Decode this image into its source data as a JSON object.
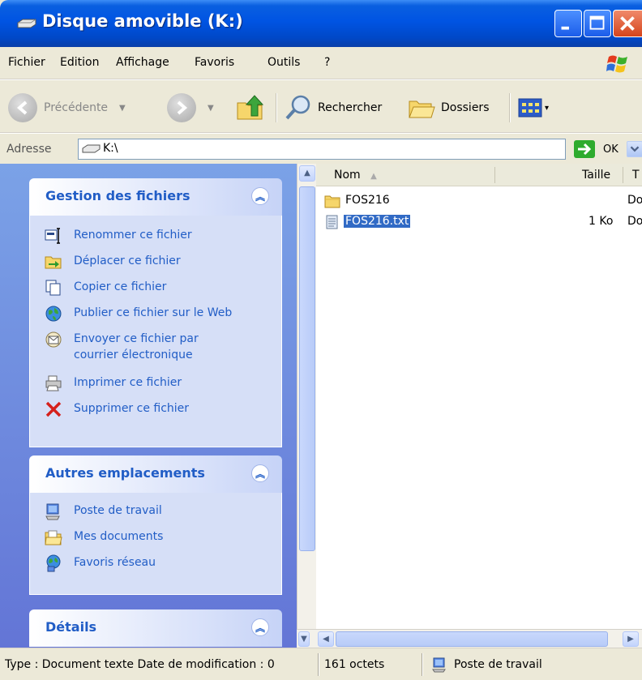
{
  "window": {
    "title": "Disque amovible (K:)",
    "title_icon": "drive-icon",
    "controls": [
      "minimize",
      "maximize",
      "close"
    ]
  },
  "menu": {
    "items": [
      "Fichier",
      "Edition",
      "Affichage",
      "Favoris",
      "Outils",
      "?"
    ]
  },
  "toolbar": {
    "back_label": "Précédente",
    "search_label": "Rechercher",
    "folders_label": "Dossiers"
  },
  "address": {
    "label": "Adresse",
    "value": "K:\\",
    "go_label": "OK"
  },
  "taskpane": {
    "file_tasks": {
      "title": "Gestion des fichiers",
      "items": [
        {
          "label": "Renommer ce fichier",
          "icon": "rename-icon"
        },
        {
          "label": "Déplacer ce fichier",
          "icon": "move-icon"
        },
        {
          "label": "Copier ce fichier",
          "icon": "copy-icon"
        },
        {
          "label": "Publier ce fichier sur le Web",
          "icon": "web-publish-icon"
        },
        {
          "label": "Envoyer ce fichier par\ncourrier électronique",
          "line1": "Envoyer ce fichier par",
          "line2": "courrier électronique",
          "icon": "email-icon"
        },
        {
          "label": "Imprimer ce fichier",
          "icon": "print-icon"
        },
        {
          "label": "Supprimer ce fichier",
          "icon": "delete-icon"
        }
      ]
    },
    "other_places": {
      "title": "Autres emplacements",
      "items": [
        {
          "label": "Poste de travail",
          "icon": "my-computer-icon"
        },
        {
          "label": "Mes documents",
          "icon": "my-documents-icon"
        },
        {
          "label": "Favoris réseau",
          "icon": "network-places-icon"
        }
      ]
    },
    "details": {
      "title": "Détails"
    }
  },
  "filelist": {
    "columns": {
      "name": "Nom",
      "size": "Taille",
      "type_partial": "T"
    },
    "rows": [
      {
        "name": "FOS216",
        "size": "",
        "type_partial": "Do",
        "icon": "folder-icon",
        "selected": false
      },
      {
        "name": "FOS216.txt",
        "size": "1 Ko",
        "type_partial": "Do",
        "icon": "text-file-icon",
        "selected": true
      }
    ]
  },
  "status": {
    "info": "Type : Document texte Date de modification : 0",
    "size": "161 octets",
    "location": "Poste de travail"
  },
  "colors": {
    "titlebar": "#0054e3",
    "taskpane_bg": "#7ba2e7",
    "link": "#215dc6",
    "selection": "#316ac5"
  }
}
